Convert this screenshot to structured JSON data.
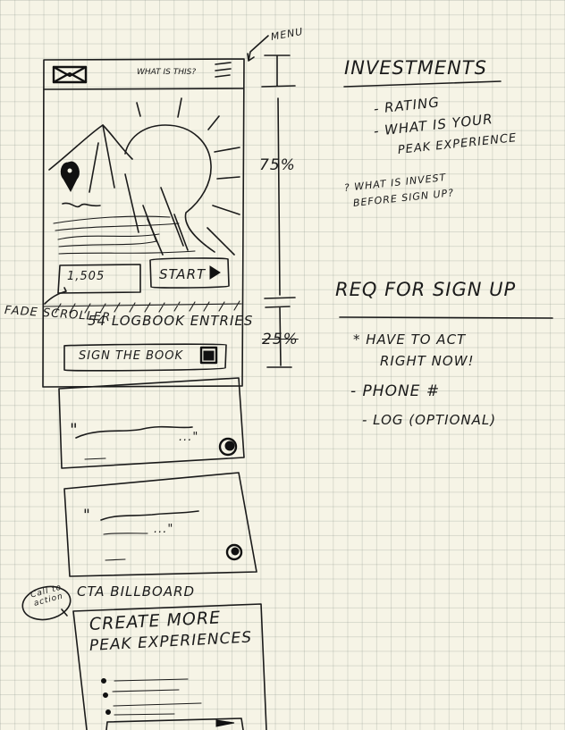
{
  "wireframe": {
    "menu_label": "MENU",
    "header_title": "WHAT IS THIS?",
    "stat_value": "1,505",
    "start_label": "START",
    "logbook_label": "54 LOGBOOK ENTRIES",
    "sign_label": "SIGN THE BOOK",
    "fade_scroller_label": "FADE SCROLLER",
    "cta_label": "CTA BILLBOARD",
    "cta_bubble": "Call to action",
    "cta_title_line1": "CREATE MORE",
    "cta_title_line2": "PEAK EXPERIENCES",
    "quote_open": "\"",
    "quote_close": "...\""
  },
  "dimensions": {
    "top_percent": "75%",
    "bottom_percent": "25%"
  },
  "notes": {
    "investments_title": "INVESTMENTS",
    "investments_items": [
      "- RATING",
      "- WHAT IS YOUR",
      "PEAK EXPERIENCE"
    ],
    "question": [
      "? WHAT IS INVEST",
      "BEFORE SIGN UP?"
    ],
    "req_title": "REQ FOR SIGN UP",
    "req_items": [
      "* HAVE TO ACT",
      "RIGHT NOW!",
      "- PHONE #",
      "- LOG (OPTIONAL)"
    ]
  },
  "colors": {
    "ink": "#1b1b1b",
    "paper": "#f6f4e6"
  }
}
